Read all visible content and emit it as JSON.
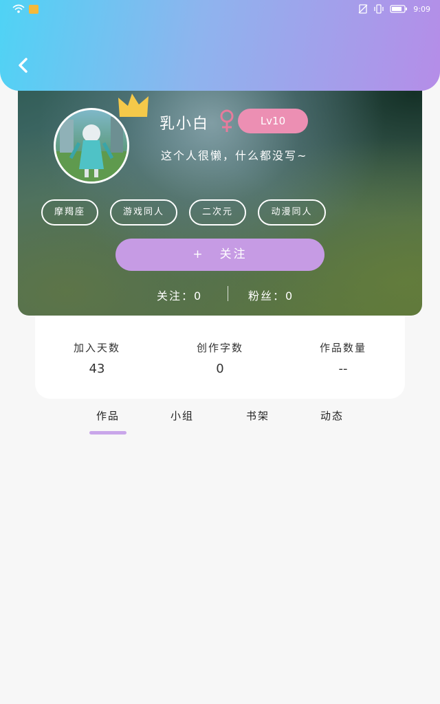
{
  "status_bar": {
    "time": "9:09"
  },
  "profile": {
    "username": "乳小白",
    "level": "Lv10",
    "bio": "这个人很懒，什么都没写~",
    "tags": [
      "摩羯座",
      "游戏同人",
      "二次元",
      "动漫同人"
    ],
    "follow_plus": "+",
    "follow_label": "关注",
    "following": "关注：0",
    "fans": "粉丝：0"
  },
  "stats": [
    {
      "label": "加入天数",
      "value": "43"
    },
    {
      "label": "创作字数",
      "value": "0"
    },
    {
      "label": "作品数量",
      "value": "--"
    }
  ],
  "tabs": [
    {
      "label": "作品",
      "active": true
    },
    {
      "label": "小组",
      "active": false
    },
    {
      "label": "书架",
      "active": false
    },
    {
      "label": "动态",
      "active": false
    }
  ],
  "colors": {
    "header_start": "#4fd3f5",
    "header_end": "#b58de8",
    "follow_button": "#c69be4",
    "level_badge": "#ec8fb3",
    "tab_indicator": "#c9a6ea"
  }
}
